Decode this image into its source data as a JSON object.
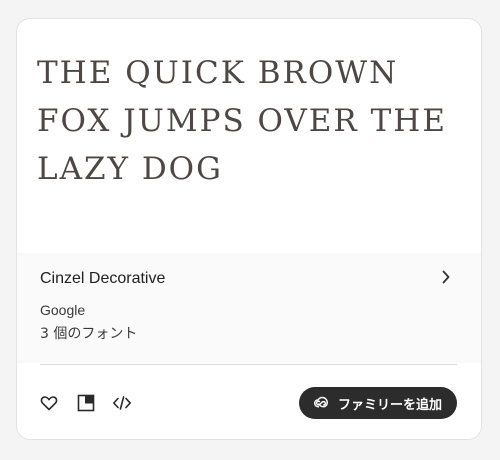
{
  "card": {
    "sample_text": "THE QUICK BROWN FOX JUMPS OVER THE LAZY DOG",
    "family_name": "Cinzel Decorative",
    "foundry": "Google",
    "font_count": "3 個のフォント",
    "add_family_label": "ファミリーを追加",
    "icons": {
      "favorite": "heart-icon",
      "preview": "preview-panel-icon",
      "embed": "code-icon",
      "details": "chevron-right-icon",
      "creative_cloud": "creative-cloud-icon"
    }
  },
  "colors": {
    "page_background": "#f4f4f4",
    "card_background": "#ffffff",
    "sample_text": "#4d4746",
    "button_background": "#2c2c2c",
    "button_text": "#ffffff"
  }
}
